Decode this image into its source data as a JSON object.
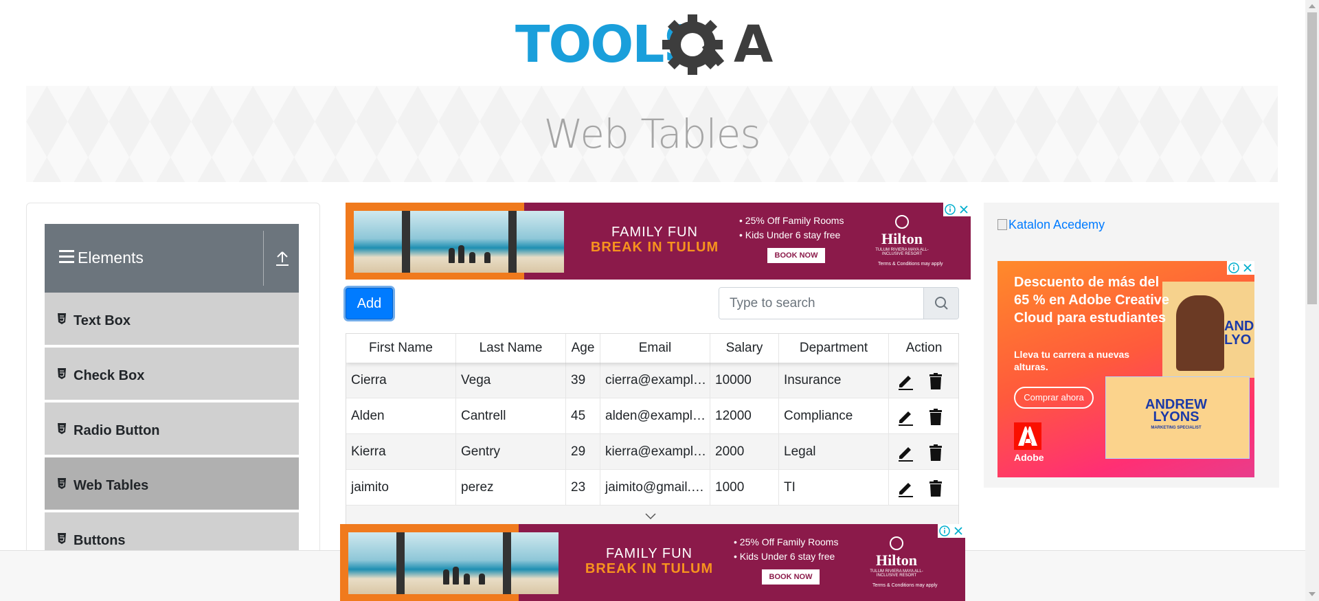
{
  "header": {
    "logo_text": "TOOLSQA",
    "page_title": "Web Tables"
  },
  "sidebar": {
    "group_title": "Elements",
    "items": [
      {
        "label": "Text Box",
        "active": false
      },
      {
        "label": "Check Box",
        "active": false
      },
      {
        "label": "Radio Button",
        "active": false
      },
      {
        "label": "Web Tables",
        "active": true
      },
      {
        "label": "Buttons",
        "active": false
      }
    ]
  },
  "toolbar": {
    "add_label": "Add",
    "search_placeholder": "Type to search"
  },
  "table": {
    "headers": [
      "First Name",
      "Last Name",
      "Age",
      "Email",
      "Salary",
      "Department",
      "Action"
    ],
    "rows": [
      [
        "Cierra",
        "Vega",
        "39",
        "cierra@example.com",
        "10000",
        "Insurance"
      ],
      [
        "Alden",
        "Cantrell",
        "45",
        "alden@example.com",
        "12000",
        "Compliance"
      ],
      [
        "Kierra",
        "Gentry",
        "29",
        "kierra@example.com",
        "2000",
        "Legal"
      ],
      [
        "jaimito",
        "perez",
        "23",
        "jaimito@gmail.com",
        "1000",
        "TI"
      ]
    ]
  },
  "ad_hilton": {
    "line1": "FAMILY FUN",
    "line2": "BREAK IN TULUM",
    "bullet1": "• 25% Off Family Rooms",
    "bullet2": "• Kids Under 6 stay free",
    "cta": "BOOK NOW",
    "brand": "Hilton",
    "brand_sub": "TULUM RIVIERA MAYA ALL-INCLUSIVE RESORT",
    "terms": "Terms & Conditions may apply"
  },
  "right_ad": {
    "katalon_link": "Katalon Acedemy",
    "headline": "Descuento de más del 65 % en Adobe Creative Cloud para estudiantes",
    "subtext": "Lleva tu carrera a nuevas alturas.",
    "cta": "Comprar ahora",
    "brand": "Adobe",
    "card_name": "ANDREW LYONS",
    "card_role": "MARKETING SPECIALIST",
    "photo_name": "AND LYO"
  },
  "colors": {
    "primary": "#007bff",
    "sidebar_header": "#6c757d",
    "menu_item": "#d0d0d0",
    "menu_item_active": "#b0b0b0",
    "logo_blue": "#1a9fdb",
    "logo_dark": "#3d3d3d"
  },
  "icons": {
    "menu": "hamburger-icon",
    "collapse": "upload-icon",
    "item": "html5-icon",
    "search": "search-icon",
    "edit": "pencil-icon",
    "delete": "trash-icon",
    "more": "chevron-down-icon",
    "ad_info": "info-icon",
    "ad_close": "close-icon"
  }
}
